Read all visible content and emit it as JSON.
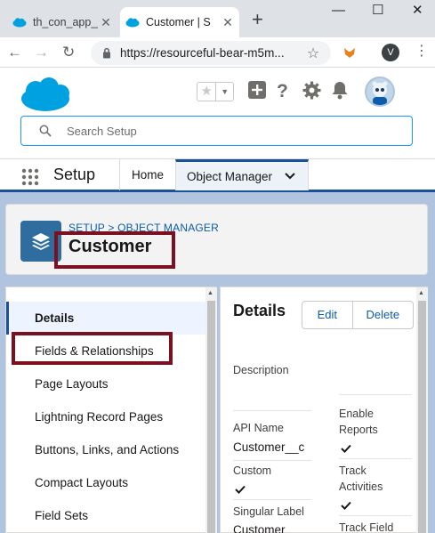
{
  "browser": {
    "tabs": [
      {
        "label": "th_con_app__",
        "active": false
      },
      {
        "label": "Customer | S",
        "active": true
      }
    ],
    "new_tab": "+",
    "window_controls": {
      "minimize": "—",
      "maximize": "☐",
      "close": "✕"
    },
    "url": "https://resourceful-bear-m5m...",
    "profile_initial": "V"
  },
  "header": {
    "search_placeholder": "Search Setup",
    "icons": [
      "favorites-star-icon",
      "add-icon",
      "help-icon",
      "setup-gear-icon",
      "notifications-bell-icon"
    ]
  },
  "appnav": {
    "title": "Setup",
    "tabs": [
      {
        "label": "Home"
      },
      {
        "label": "Object Manager"
      }
    ]
  },
  "object": {
    "breadcrumb": "SETUP > OBJECT MANAGER",
    "title": "Customer"
  },
  "sidebar": {
    "items": [
      {
        "label": "Details",
        "selected": true
      },
      {
        "label": "Fields & Relationships"
      },
      {
        "label": "Page Layouts"
      },
      {
        "label": "Lightning Record Pages"
      },
      {
        "label": "Buttons, Links, and Actions"
      },
      {
        "label": "Compact Layouts"
      },
      {
        "label": "Field Sets"
      }
    ]
  },
  "details": {
    "title": "Details",
    "edit_label": "Edit",
    "delete_label": "Delete",
    "description_label": "Description",
    "api_name_label": "API Name",
    "api_name_value": "Customer__c",
    "custom_label": "Custom",
    "singular_label_label": "Singular Label",
    "singular_label_value": "Customer",
    "enable_reports_label": "Enable Reports",
    "track_activities_label": "Track Activities",
    "track_field_label": "Track Field"
  },
  "colors": {
    "accent": "#1b5297",
    "highlight": "#7b1020",
    "body_bg": "#b0c4df"
  }
}
